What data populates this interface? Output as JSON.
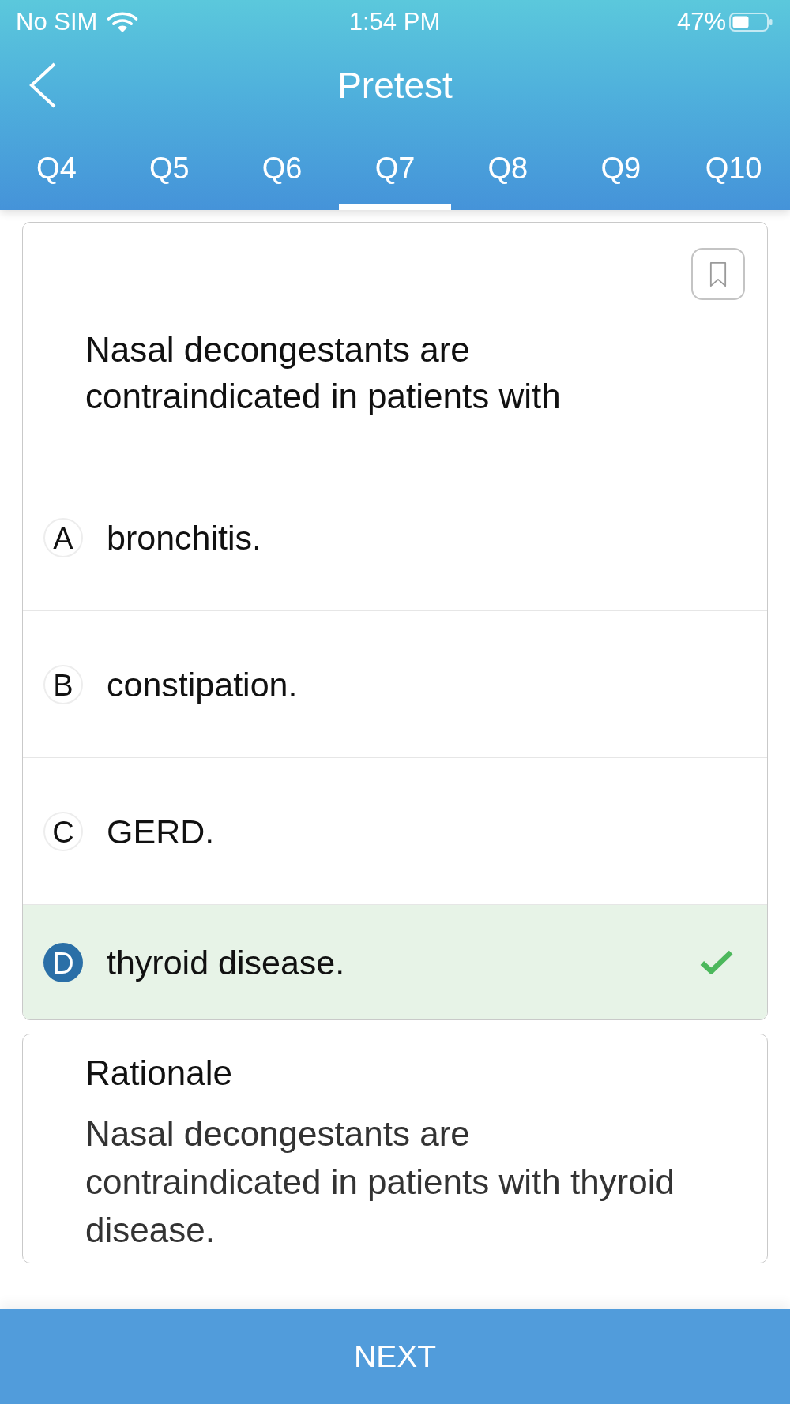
{
  "status_bar": {
    "carrier": "No SIM",
    "time": "1:54 PM",
    "battery": "47%"
  },
  "nav": {
    "title": "Pretest"
  },
  "tabs": [
    {
      "label": "Q4",
      "selected": false
    },
    {
      "label": "Q5",
      "selected": false
    },
    {
      "label": "Q6",
      "selected": false
    },
    {
      "label": "Q7",
      "selected": true
    },
    {
      "label": "Q8",
      "selected": false
    },
    {
      "label": "Q9",
      "selected": false
    },
    {
      "label": "Q10",
      "selected": false
    }
  ],
  "question": {
    "text": "Nasal decongestants are\ncontraindicated in patients with"
  },
  "options": [
    {
      "letter": "A",
      "text": "bronchitis.",
      "selected": false,
      "correct": false
    },
    {
      "letter": "B",
      "text": "constipation.",
      "selected": false,
      "correct": false
    },
    {
      "letter": "C",
      "text": "GERD.",
      "selected": false,
      "correct": false
    },
    {
      "letter": "D",
      "text": "thyroid disease.",
      "selected": true,
      "correct": true
    }
  ],
  "rationale": {
    "title": "Rationale",
    "text": "Nasal decongestants are\ncontraindicated in patients with thyroid disease."
  },
  "next_button": {
    "label": "NEXT"
  }
}
